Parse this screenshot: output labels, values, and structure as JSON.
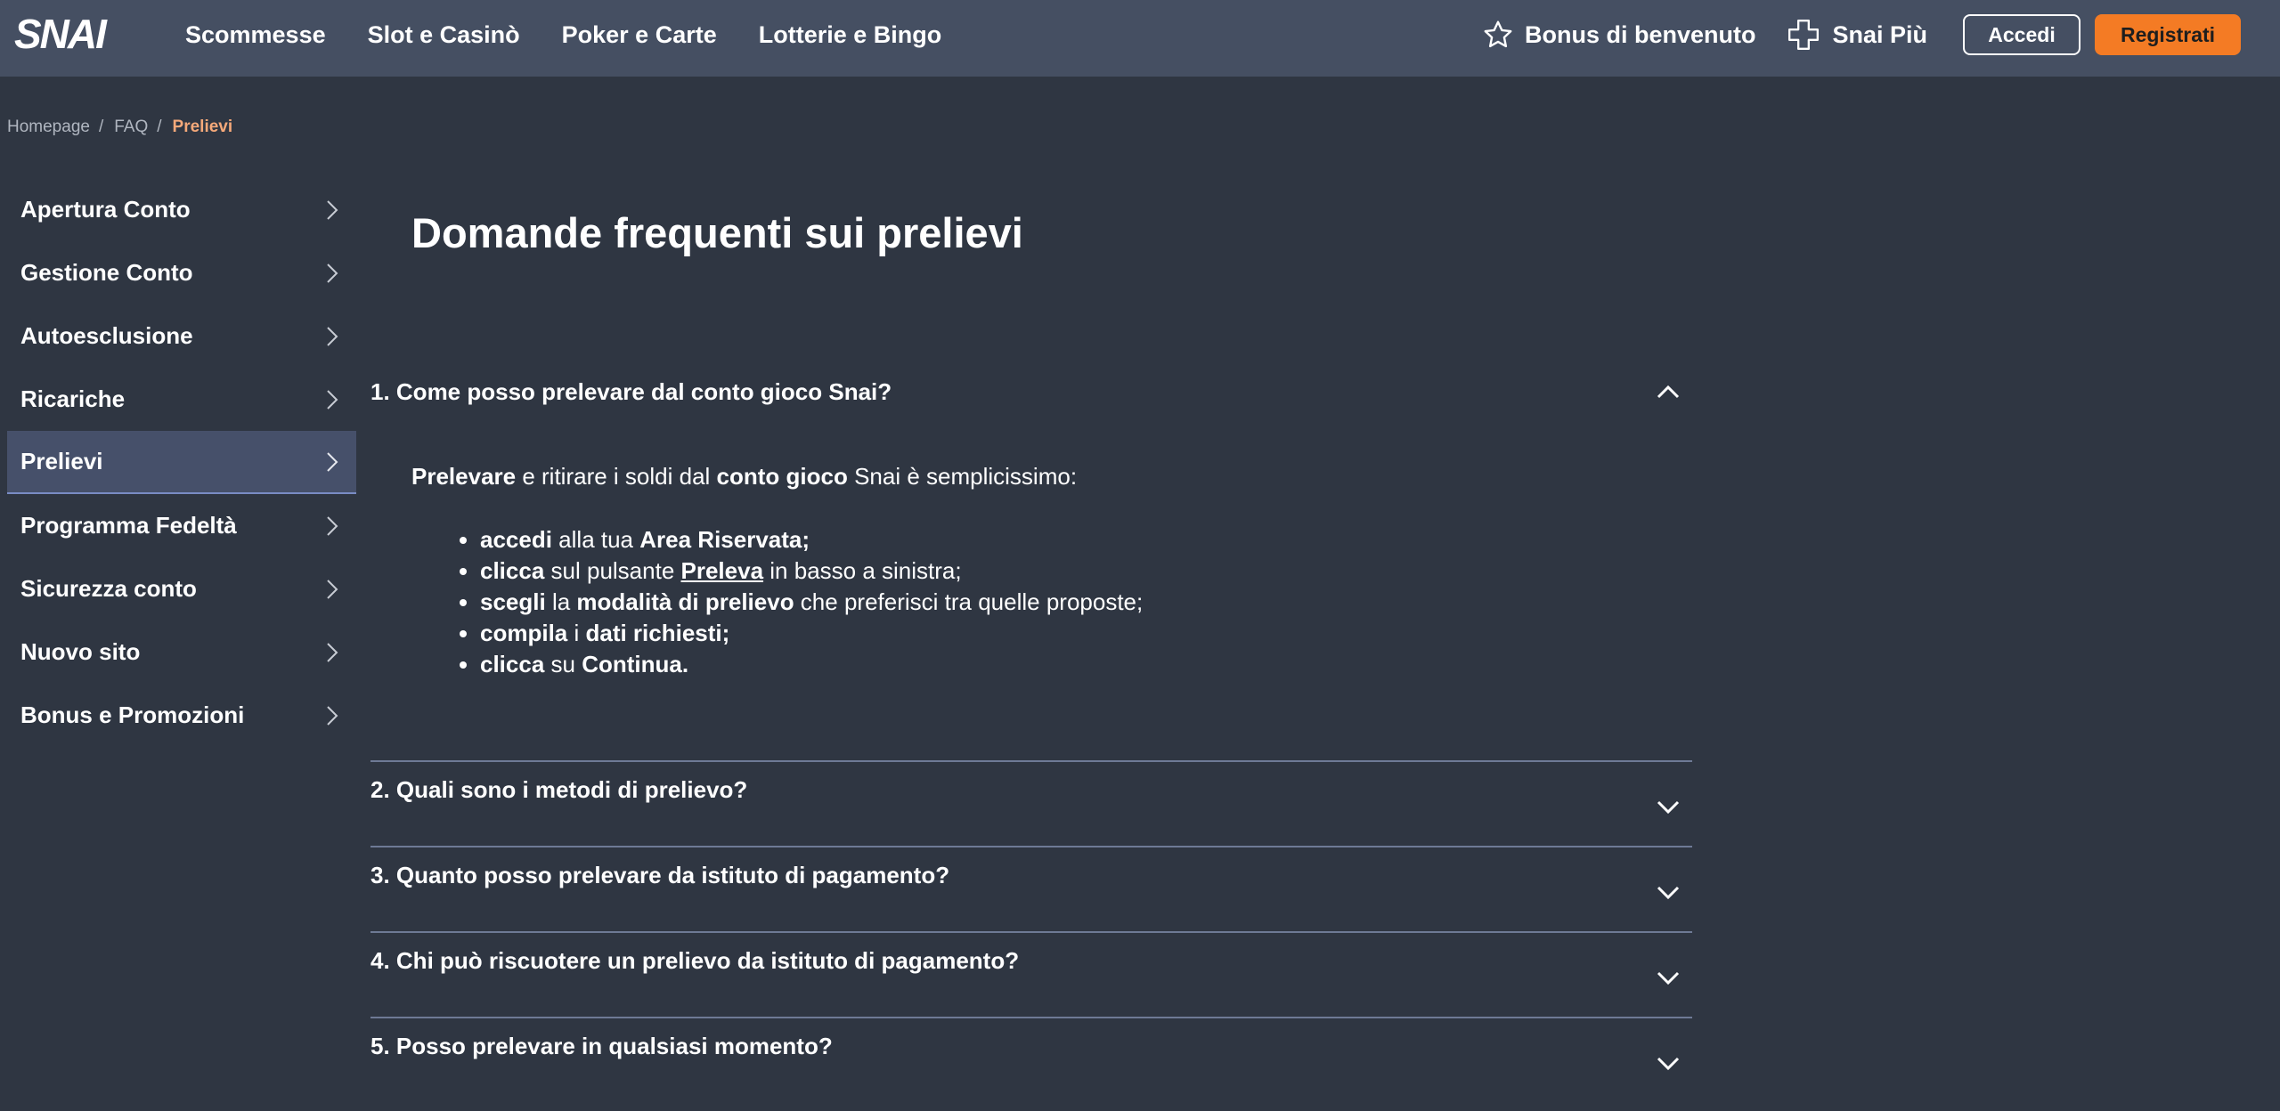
{
  "header": {
    "logo_text": "SNAI",
    "nav": [
      "Scommesse",
      "Slot e Casinò",
      "Poker e Carte",
      "Lotterie e Bingo"
    ],
    "bonus_label": "Bonus di benvenuto",
    "snai_piu_label": "Snai Più",
    "login_label": "Accedi",
    "register_label": "Registrati",
    "accent_color": "#f47b24",
    "bar_color": "#454f62"
  },
  "breadcrumb": {
    "home": "Homepage",
    "faq": "FAQ",
    "current": "Prelievi"
  },
  "sidebar": {
    "items": [
      {
        "label": "Apertura Conto"
      },
      {
        "label": "Gestione Conto"
      },
      {
        "label": "Autoesclusione"
      },
      {
        "label": "Ricariche"
      },
      {
        "label": "Prelievi"
      },
      {
        "label": "Programma Fedeltà"
      },
      {
        "label": "Sicurezza conto"
      },
      {
        "label": "Nuovo sito"
      },
      {
        "label": "Bonus e Promozioni"
      }
    ],
    "active": "Prelievi"
  },
  "main": {
    "title": "Domande frequenti sui prelievi",
    "faq": [
      {
        "question": "1. Come posso prelevare dal conto gioco Snai?",
        "expanded": true
      },
      {
        "question": "2. Quali sono i metodi di prelievo?",
        "expanded": false
      },
      {
        "question": "3. Quanto posso prelevare da istituto di pagamento?",
        "expanded": false
      },
      {
        "question": "4. Chi può riscuotere un prelievo da istituto di pagamento?",
        "expanded": false
      },
      {
        "question": "5. Posso prelevare in qualsiasi momento?",
        "expanded": false
      }
    ],
    "answer": {
      "intro_b1": "Prelevare",
      "intro_t1": " e ritirare i soldi dal ",
      "intro_b2": "conto gioco",
      "intro_t2": " Snai è semplicissimo:",
      "steps": [
        {
          "b1": "accedi",
          "t1": " alla tua ",
          "b2": "Area Riservata;",
          "t2": ""
        },
        {
          "b1": "clicca",
          "t1": " sul pulsante ",
          "link": "Preleva",
          "t2": " in basso a sinistra;"
        },
        {
          "b1": "scegli",
          "t1": " la ",
          "b2": "modalità di prelievo",
          "t2": " che preferisci tra quelle proposte;"
        },
        {
          "b1": "compila",
          "t1": " i ",
          "b2": "dati richiesti;",
          "t2": ""
        },
        {
          "b1": "clicca",
          "t1": " su ",
          "b2": "Continua.",
          "t2": ""
        }
      ]
    }
  }
}
